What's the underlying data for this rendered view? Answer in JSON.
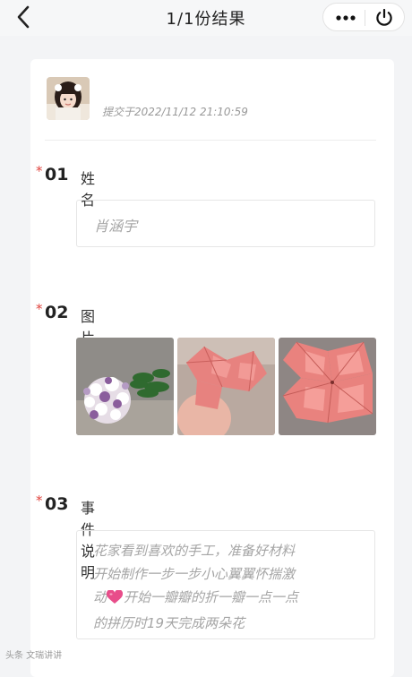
{
  "nav": {
    "title": "1/1份结果"
  },
  "submission": {
    "time_text": "提交于2022/11/12 21:10:59"
  },
  "questions": [
    {
      "star": "*",
      "num": "01",
      "label": "姓名",
      "answer": "肖涵宇"
    },
    {
      "star": "*",
      "num": "02",
      "label": "图片",
      "images": [
        "flower-bouquet-photo",
        "pink-origami-flower-in-hand-photo",
        "pink-origami-flower-closeup-photo"
      ]
    },
    {
      "star": "*",
      "num": "03",
      "label": "事件说明",
      "answer_lines": [
        "花家看到喜欢的手工，准备好材料",
        "开始制作一步一步小心翼翼怀揣激",
        "动",
        "开始一瓣瓣的折一瓣一点一点",
        "的拼历时19天完成两朵花"
      ]
    }
  ],
  "watermark": "头条 文瑞讲讲",
  "colors": {
    "required_star": "#e0443e",
    "heart": "#e84d8a"
  }
}
